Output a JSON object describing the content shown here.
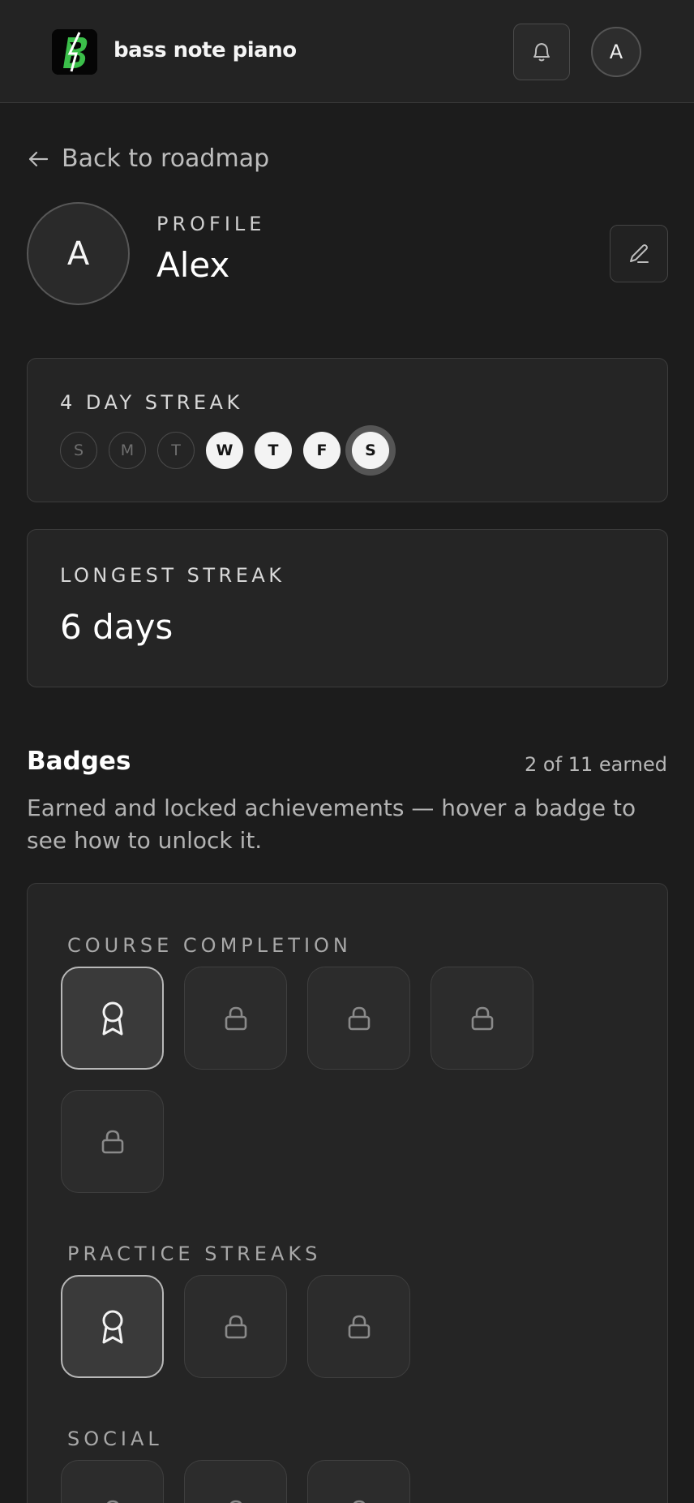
{
  "app": {
    "name": "bass note piano"
  },
  "header": {
    "avatar_initial": "A",
    "icons": [
      "bell-icon"
    ]
  },
  "back_link": {
    "label": "Back to roadmap"
  },
  "profile": {
    "section_label": "PROFILE",
    "name": "Alex",
    "initial": "A"
  },
  "streak": {
    "title": "4 DAY STREAK",
    "days": [
      {
        "letter": "S",
        "state": "missed"
      },
      {
        "letter": "M",
        "state": "missed"
      },
      {
        "letter": "T",
        "state": "missed"
      },
      {
        "letter": "W",
        "state": "done"
      },
      {
        "letter": "T",
        "state": "done"
      },
      {
        "letter": "F",
        "state": "done"
      },
      {
        "letter": "S",
        "state": "today"
      }
    ]
  },
  "longest": {
    "label": "LONGEST STREAK",
    "value": "6 days"
  },
  "badges": {
    "title": "Badges",
    "count": "2 of 11 earned",
    "description": "Earned and locked achievements — hover a badge to see how to unlock it.",
    "sections": [
      {
        "label": "COURSE COMPLETION",
        "items": [
          "earned",
          "locked",
          "locked",
          "locked",
          "locked"
        ]
      },
      {
        "label": "PRACTICE STREAKS",
        "items": [
          "earned",
          "locked",
          "locked"
        ]
      },
      {
        "label": "SOCIAL",
        "items": [
          "locked",
          "locked",
          "locked"
        ]
      }
    ]
  },
  "colors": {
    "background": "#1c1c1c",
    "card": "#252525",
    "accent_green": "#3bbf4a"
  }
}
